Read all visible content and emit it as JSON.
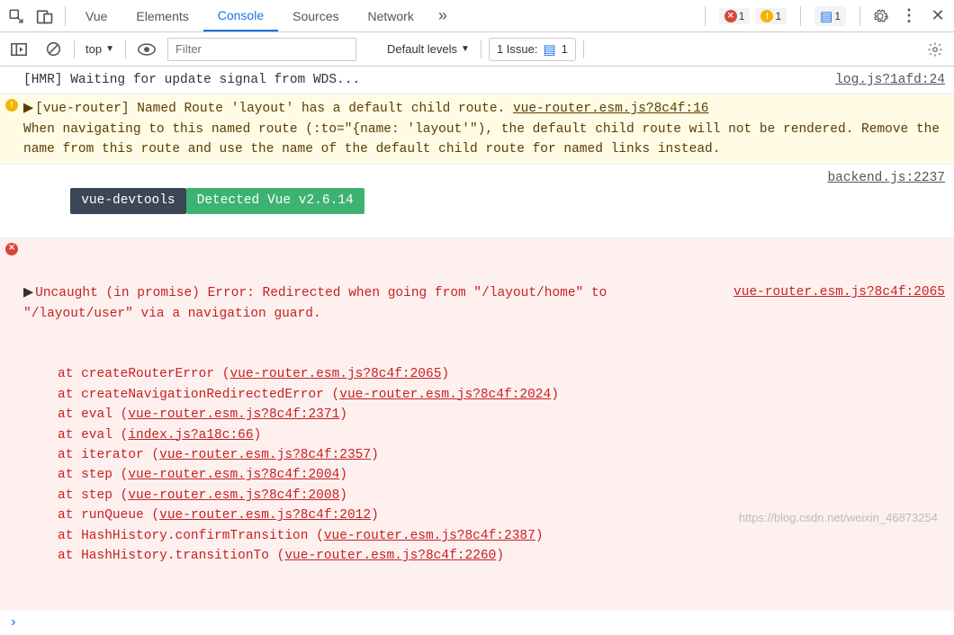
{
  "tabs": {
    "vue": "Vue",
    "elements": "Elements",
    "console": "Console",
    "sources": "Sources",
    "network": "Network"
  },
  "status": {
    "errors": "1",
    "warnings": "1",
    "messages": "1"
  },
  "toolbar": {
    "context": "top",
    "filter_placeholder": "Filter",
    "levels": "Default levels",
    "issues_label": "1 Issue:",
    "issues_count": "1"
  },
  "msg_hmr": {
    "text": "[HMR] Waiting for update signal from WDS...",
    "src": "log.js?1afd:24"
  },
  "msg_warn": {
    "prefix": "[vue-router] Named Route 'layout' has a default child route. ",
    "link1": "vue-router.esm.js?8c4f:16",
    "rest": "When navigating to this named route (:to=\"{name: 'layout'\"), the default child route will not be rendered. Remove the name from this route and use the name of the default child route for named links instead."
  },
  "msg_devtools": {
    "pill1": "vue-devtools",
    "pill2": "Detected Vue v2.6.14",
    "src": "backend.js:2237"
  },
  "msg_error": {
    "headline": "Uncaught (in promise) Error: Redirected when going from \"/layout/home\" to \"/layout/user\" via a navigation guard.",
    "src": "vue-router.esm.js?8c4f:2065",
    "trace": [
      {
        "fn": "createRouterError",
        "loc": "vue-router.esm.js?8c4f:2065"
      },
      {
        "fn": "createNavigationRedirectedError",
        "loc": "vue-router.esm.js?8c4f:2024"
      },
      {
        "fn": "eval",
        "loc": "vue-router.esm.js?8c4f:2371"
      },
      {
        "fn": "eval",
        "loc": "index.js?a18c:66"
      },
      {
        "fn": "iterator",
        "loc": "vue-router.esm.js?8c4f:2357"
      },
      {
        "fn": "step",
        "loc": "vue-router.esm.js?8c4f:2004"
      },
      {
        "fn": "step",
        "loc": "vue-router.esm.js?8c4f:2008"
      },
      {
        "fn": "runQueue",
        "loc": "vue-router.esm.js?8c4f:2012"
      },
      {
        "fn": "HashHistory.confirmTransition",
        "loc": "vue-router.esm.js?8c4f:2387"
      },
      {
        "fn": "HashHistory.transitionTo",
        "loc": "vue-router.esm.js?8c4f:2260"
      }
    ]
  },
  "prompt_char": "›",
  "watermark": "https://blog.csdn.net/weixin_46873254"
}
